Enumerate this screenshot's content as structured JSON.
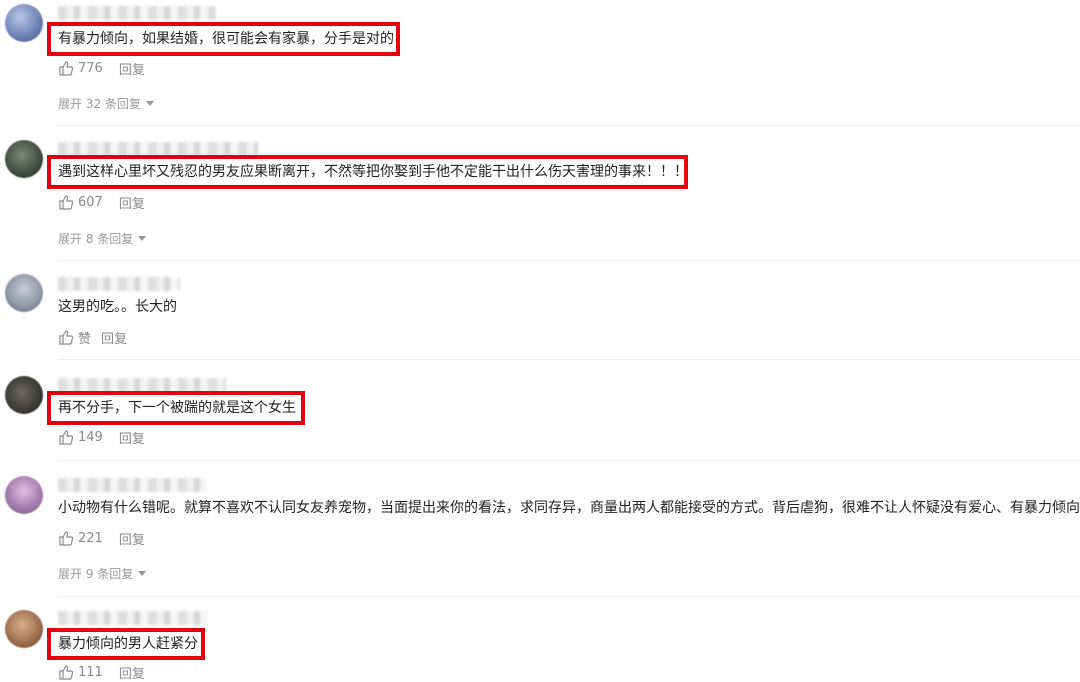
{
  "comments": [
    {
      "text": "有暴力倾向，如果结婚，很可能会有家暴，分手是对的",
      "likes": "776",
      "reply": "回复",
      "expand": "展开 32 条回复"
    },
    {
      "text": "遇到这样心里坏又残忍的男友应果断离开，不然等把你娶到手他不定能干出什么伤天害理的事来！！！",
      "likes": "607",
      "reply": "回复",
      "expand": "展开 8 条回复"
    },
    {
      "text": "这男的吃。。长大的",
      "likes": "赞",
      "reply": "回复"
    },
    {
      "text": "再不分手，下一个被踹的就是这个女生",
      "likes": "149",
      "reply": "回复"
    },
    {
      "text": "小动物有什么错呢。就算不喜欢不认同女友养宠物，当面提出来你的看法，求同存异，商量出两人都能接受的方式。背后虐狗，很难不让人怀疑没有爱心、有暴力倾向。",
      "likes": "221",
      "reply": "回复",
      "expand": "展开 9 条回复"
    },
    {
      "text": "暴力倾向的男人赶紧分",
      "likes": "111",
      "reply": "回复"
    }
  ],
  "colors": {
    "highlight": "#e3000f",
    "meta": "#8a8a8a",
    "expand": "#999999"
  },
  "icons": {
    "like": "thumbs-up-icon",
    "expand": "caret-down-icon"
  }
}
